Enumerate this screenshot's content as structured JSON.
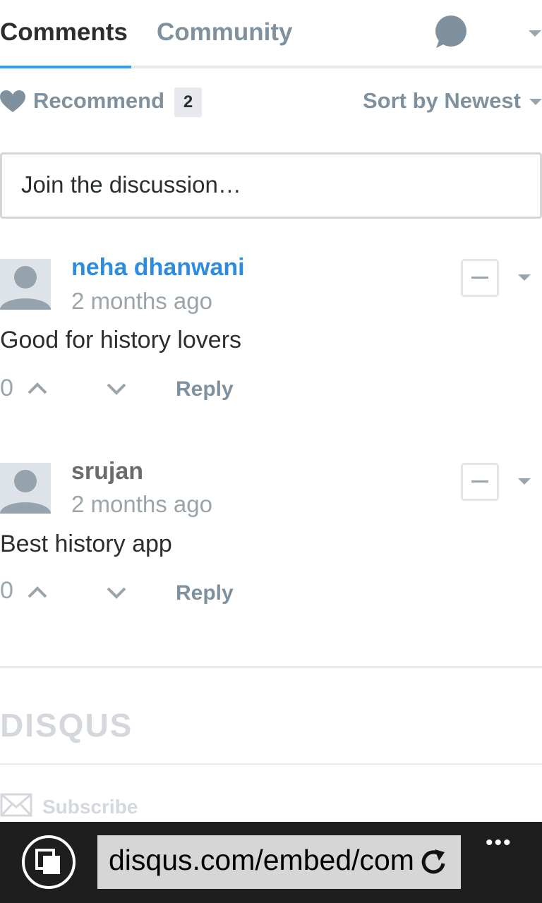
{
  "tabs": {
    "comments": "Comments",
    "community": "Community"
  },
  "toolbar": {
    "recommend_label": "Recommend",
    "recommend_count": "2",
    "sort_label": "Sort by Newest"
  },
  "composer": {
    "placeholder": "Join the discussion…"
  },
  "comments": [
    {
      "author": "neha dhanwani",
      "author_color": "#2e8ce0",
      "time": "2 months ago",
      "text": "Good for history lovers",
      "votes": "0",
      "reply_label": "Reply"
    },
    {
      "author": "srujan",
      "author_color": "#6b6b6b",
      "time": "2 months ago",
      "text": "Best history app",
      "votes": "0",
      "reply_label": "Reply"
    }
  ],
  "footer": {
    "logo": "DISQUS",
    "subscribe_label": "Subscribe"
  },
  "browser": {
    "address": "disqus.com/embed/com",
    "more_label": "•••"
  },
  "colors": {
    "accent": "#2e9fff",
    "muted": "#7f919e",
    "browser_bar": "#1e1e1e"
  }
}
